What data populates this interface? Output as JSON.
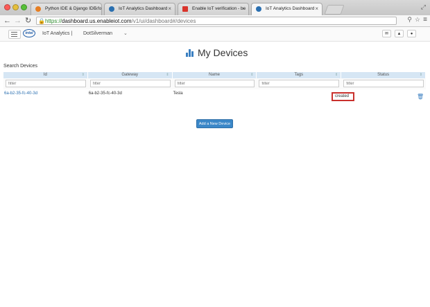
{
  "browser": {
    "tabs": [
      {
        "label": "Python IDE & Django IDE fo",
        "favicon_color": "#e67e22"
      },
      {
        "label": "IoT Analytics Dashboard",
        "favicon_color": "#2a6fb0"
      },
      {
        "label": "Enable IoT verification - be",
        "favicon_color": "#d9342b"
      },
      {
        "label": "IoT Analytics Dashboard",
        "favicon_color": "#2a6fb0"
      }
    ],
    "url_scheme": "https://",
    "url_host": "dashboard.us.enableiot.com",
    "url_path": "/v1/ui/dashboard#/devices"
  },
  "header": {
    "logo_text": "intel",
    "brand": "IoT Analytics |",
    "account": "DotSilverman",
    "account_chevron": "⌄"
  },
  "page": {
    "title": "My Devices",
    "search_label": "Search Devices",
    "columns": [
      "Id",
      "Gateway",
      "Name",
      "Tags",
      "Status"
    ],
    "filter_placeholder": "filter",
    "rows": [
      {
        "id": "6a-b2-35-fc-40-3d",
        "gateway": "6a-b2-35-fc-40-3d",
        "name": "Tesla",
        "tags": "",
        "status": "created"
      }
    ],
    "add_button": "Add a New Device"
  },
  "colors": {
    "accent": "#3a87c8",
    "highlight": "#c9302c",
    "grid_header": "#d6e6f4"
  }
}
